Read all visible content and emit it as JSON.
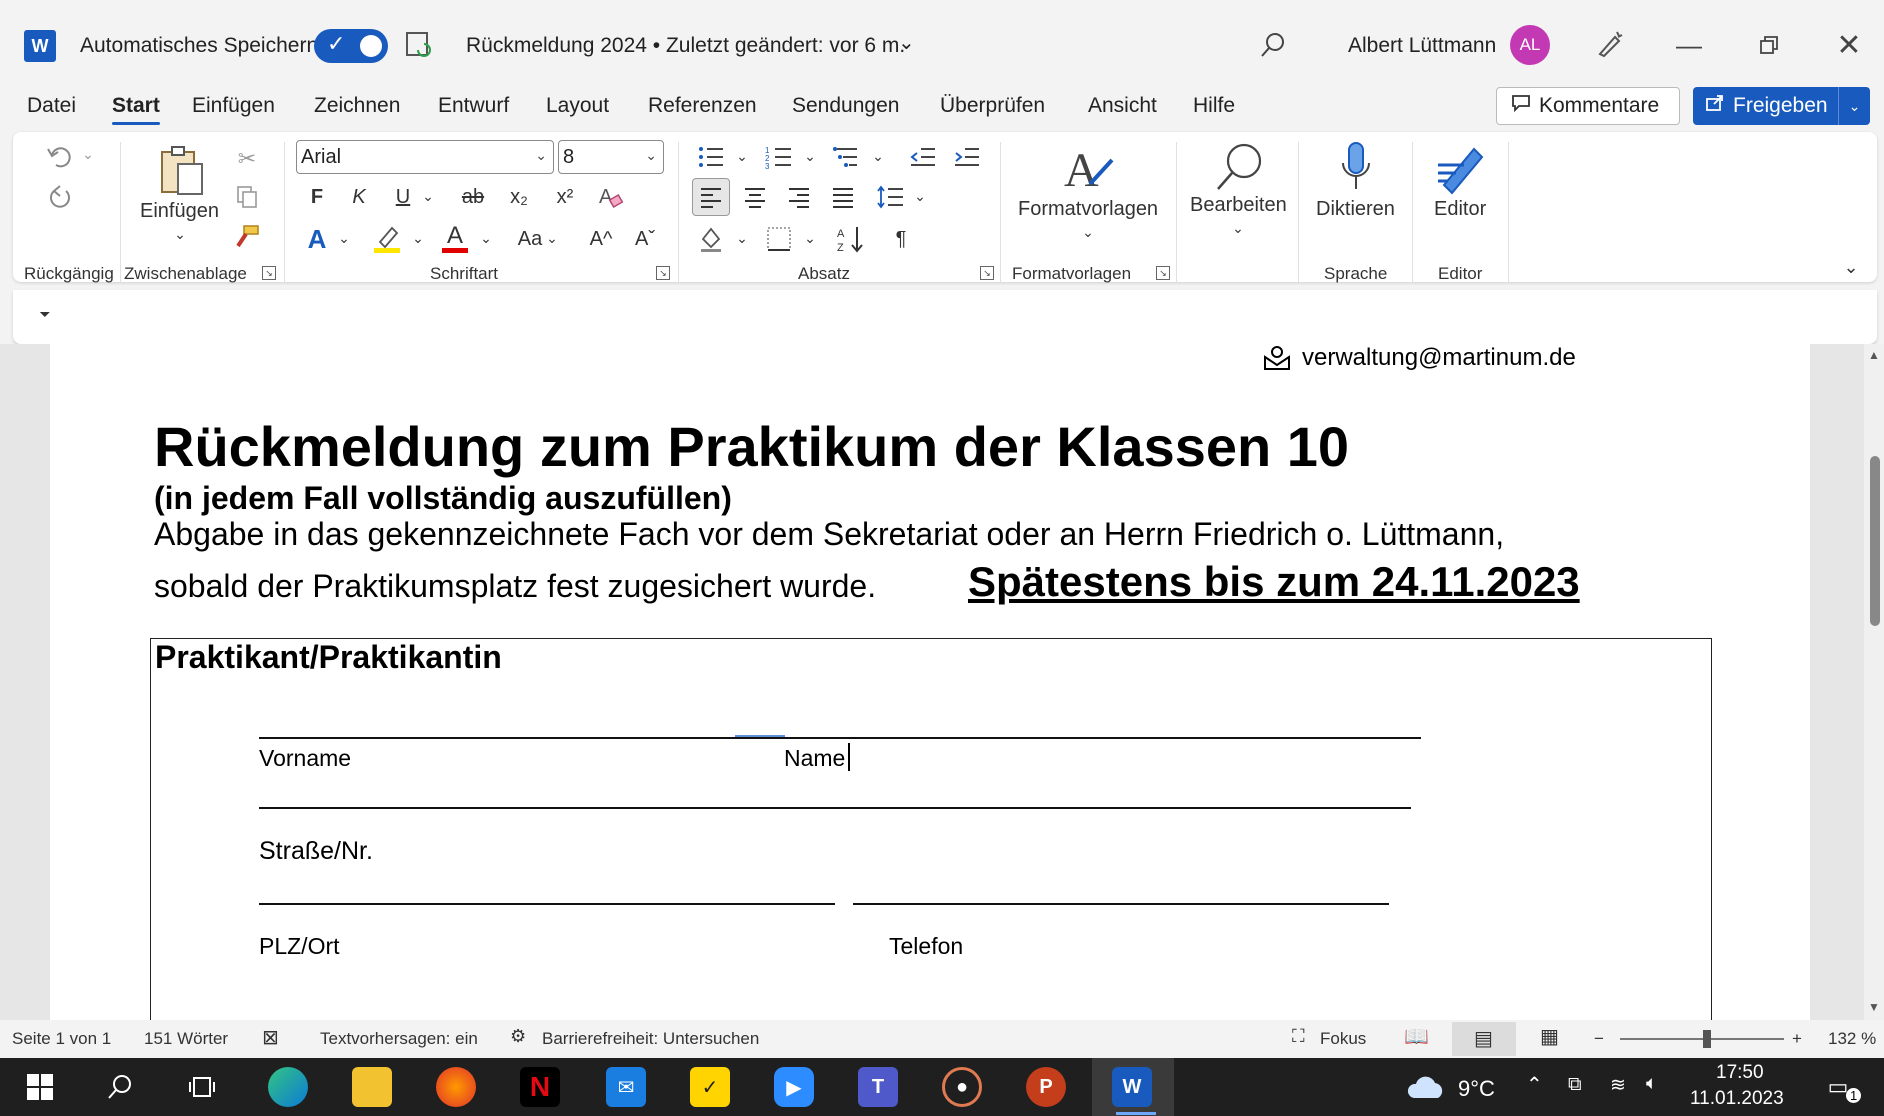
{
  "app": {
    "logo_letter": "W"
  },
  "titlebar": {
    "autosave_label": "Automatisches Speichern",
    "document_title": "Rückmeldung 2024 • Zuletzt geändert: vor 6 m.",
    "user_name": "Albert Lüttmann",
    "avatar_initials": "AL"
  },
  "menu": {
    "tabs": [
      "Datei",
      "Start",
      "Einfügen",
      "Zeichnen",
      "Entwurf",
      "Layout",
      "Referenzen",
      "Sendungen",
      "Überprüfen",
      "Ansicht",
      "Hilfe"
    ],
    "active_tab": "Start",
    "comments_label": "Kommentare",
    "share_label": "Freigeben"
  },
  "ribbon": {
    "groups": {
      "undo": "Rückgängig",
      "clipboard": "Zwischenablage",
      "font": "Schriftart",
      "paragraph": "Absatz",
      "styles": "Formatvorlagen",
      "voice": "Sprache",
      "editor": "Editor"
    },
    "paste_label": "Einfügen",
    "font_name": "Arial",
    "font_size": "8",
    "bold": "F",
    "italic": "K",
    "underline": "U",
    "strike": "ab",
    "subscript": "x₂",
    "superscript": "x²",
    "case": "Aa",
    "grow": "A^",
    "shrink": "Aˇ",
    "pilcrow": "¶",
    "styles_label": "Formatvorlagen",
    "edit_label": "Bearbeiten",
    "dictate_label": "Diktieren",
    "editor_label": "Editor"
  },
  "document": {
    "email": "verwaltung@martinum.de",
    "heading": "Rückmeldung zum Praktikum der Klassen 10",
    "subheading": "(in jedem Fall  vollständig auszufüllen)",
    "instruction_line1": "Abgabe in das gekennzeichnete Fach vor dem Sekretariat oder an Herrn Friedrich o. Lüttmann,",
    "instruction_line2": "sobald der Praktikumsplatz fest zugesichert wurde.",
    "deadline": "Spätestens bis zum 24.11.2023",
    "section_title": "Praktikant/Praktikantin",
    "fields": {
      "first_name": "Vorname",
      "last_name": "Name",
      "street": "Straße/Nr.",
      "zip_city": "PLZ/Ort",
      "phone": "Telefon"
    }
  },
  "statusbar": {
    "page": "Seite 1 von 1",
    "words": "151 Wörter",
    "predictions": "Textvorhersagen: ein",
    "accessibility": "Barrierefreiheit: Untersuchen",
    "focus": "Fokus",
    "zoom": "132 %",
    "zoom_minus": "−",
    "zoom_plus": "+"
  },
  "taskbar": {
    "temperature": "9°C",
    "time": "17:50",
    "date": "11.01.2023",
    "notification_count": "1"
  },
  "colors": {
    "accent": "#185abd",
    "avatar": "#c239b3",
    "taskbar": "#1f1f1f"
  }
}
